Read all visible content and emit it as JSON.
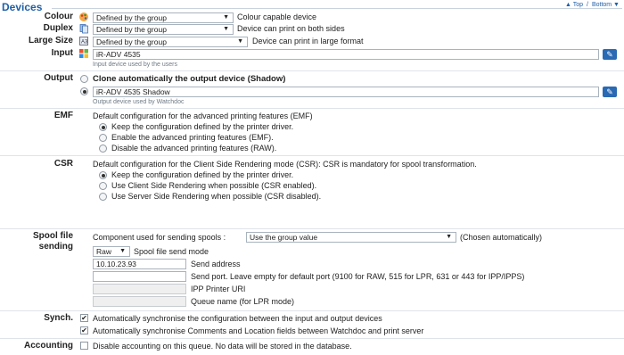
{
  "header": {
    "title": "Devices",
    "nav_top": "▲ Top",
    "nav_divider": "/",
    "nav_bottom": "Bottom ▼"
  },
  "colour": {
    "label": "Colour",
    "value": "Defined by the group",
    "description": "Colour capable device",
    "icon": "colour-palette-icon"
  },
  "duplex": {
    "label": "Duplex",
    "value": "Defined by the group",
    "description": "Device can print on both sides",
    "icon": "duplex-page-icon"
  },
  "large_size": {
    "label": "Large Size",
    "value": "Defined by the group",
    "description": "Device can print in large format",
    "icon": "large-format-icon"
  },
  "input": {
    "label": "Input",
    "value": "iR-ADV 4535",
    "hint": "Input device used by the users",
    "icon": "windows-printer-icon",
    "edit_icon": "edit-pencil-icon"
  },
  "output": {
    "label": "Output",
    "option_clone": "Clone automatically the output device (Shadow)",
    "value": "iR-ADV 4535 Shadow",
    "hint": "Output device used by Watchdoc",
    "selected": "device"
  },
  "emf": {
    "label": "EMF",
    "intro": "Default configuration for the advanced printing features (EMF)",
    "options": [
      "Keep the configuration defined by the printer driver.",
      "Enable the advanced printing features (EMF).",
      "Disable the advanced printing features (RAW)."
    ],
    "selected_index": 0
  },
  "csr": {
    "label": "CSR",
    "intro": "Default configuration for the Client Side Rendering mode (CSR): CSR is mandatory for spool transformation.",
    "options": [
      "Keep the configuration defined by the printer driver.",
      "Use Client Side Rendering when possible (CSR enabled).",
      "Use Server Side Rendering when possible (CSR disabled)."
    ],
    "selected_index": 0
  },
  "spool": {
    "label_line1": "Spool file",
    "label_line2": "sending",
    "component_label": "Component used for sending spools :",
    "component_value": "Use the group value",
    "component_note": "(Chosen automatically)",
    "mode_value": "Raw",
    "mode_label": "Spool file send mode",
    "address_value": "10.10.23.93",
    "address_label": "Send address",
    "port_value": "",
    "port_label": "Send port. Leave empty for default port (9100 for RAW, 515 for LPR, 631 or 443 for IPP/IPPS)",
    "ipp_label": "IPP Printer URI",
    "queue_label": "Queue name (for LPR mode)"
  },
  "synch": {
    "label": "Synch.",
    "option1": "Automatically synchronise the configuration between the input and output devices",
    "option2": "Automatically synchronise Comments and Location fields between Watchdoc and print server",
    "option1_checked": true,
    "option2_checked": true,
    "checkmark": "✔"
  },
  "accounting": {
    "label": "Accounting",
    "option": "Disable accounting on this queue. No data will be stored in the database.",
    "checked": false
  },
  "colors": {
    "accent": "#1f5fa8",
    "edit_button": "#2a69b3"
  }
}
